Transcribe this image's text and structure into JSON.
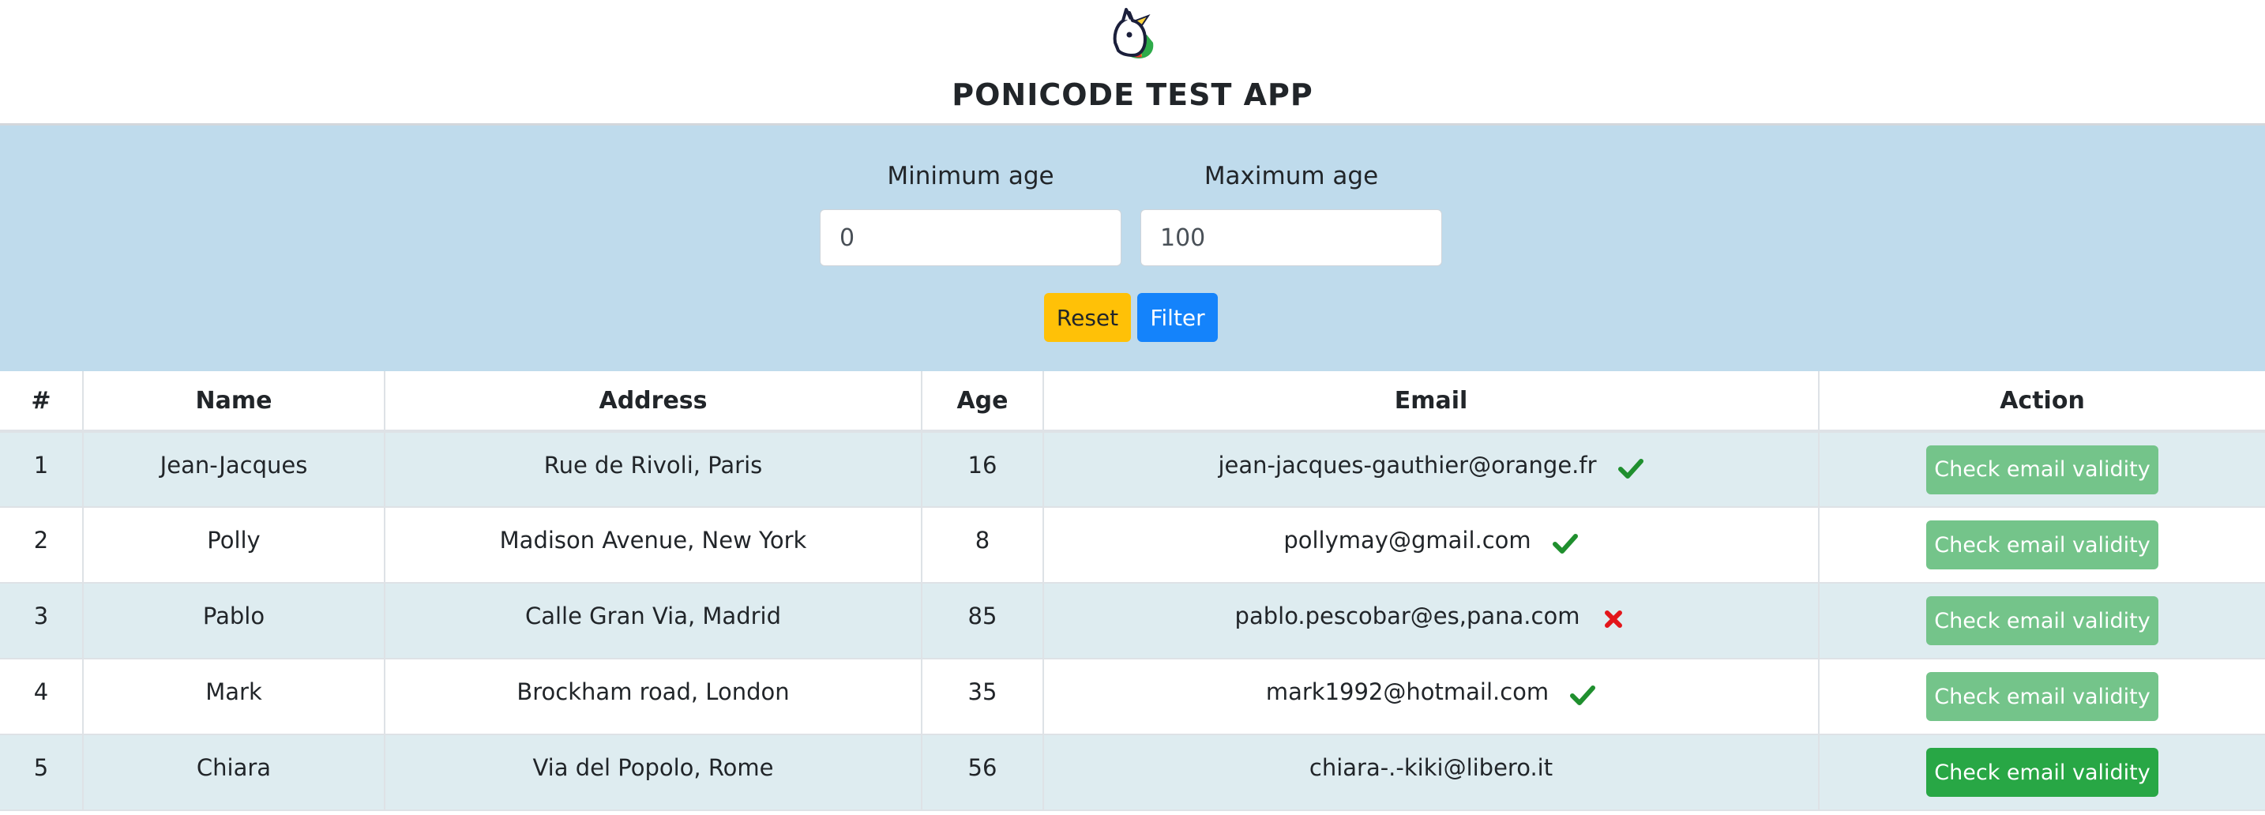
{
  "app": {
    "title": "PONICODE TEST APP"
  },
  "filters": {
    "min_label": "Minimum age",
    "max_label": "Maximum age",
    "min_value": "0",
    "max_value": "100",
    "reset_label": "Reset",
    "filter_label": "Filter"
  },
  "table": {
    "headers": {
      "index": "#",
      "name": "Name",
      "address": "Address",
      "age": "Age",
      "email": "Email",
      "action": "Action"
    },
    "rows": [
      {
        "index": "1",
        "name": "Jean-Jacques",
        "address": "Rue de Rivoli, Paris",
        "age": "16",
        "email": "jean-jacques-gauthier@orange.fr",
        "status": "valid",
        "action_label": "Check email validity",
        "action_state": "faded"
      },
      {
        "index": "2",
        "name": "Polly",
        "address": "Madison Avenue, New York",
        "age": "8",
        "email": "pollymay@gmail.com",
        "status": "valid",
        "action_label": "Check email validity",
        "action_state": "faded"
      },
      {
        "index": "3",
        "name": "Pablo",
        "address": "Calle Gran Via, Madrid",
        "age": "85",
        "email": "pablo.pescobar@es,pana.com",
        "status": "invalid",
        "action_label": "Check email validity",
        "action_state": "faded"
      },
      {
        "index": "4",
        "name": "Mark",
        "address": "Brockham road, London",
        "age": "35",
        "email": "mark1992@hotmail.com",
        "status": "valid",
        "action_label": "Check email validity",
        "action_state": "faded"
      },
      {
        "index": "5",
        "name": "Chiara",
        "address": "Via del Popolo, Rome",
        "age": "56",
        "email": "chiara-.-kiki@libero.it",
        "status": "unchecked",
        "action_label": "Check email validity",
        "action_state": "active"
      }
    ]
  },
  "icons": {
    "logo": "unicorn-logo-icon",
    "valid": "checkmark-icon",
    "invalid": "cross-icon"
  },
  "colors": {
    "filter_panel_bg": "#bfdbec",
    "reset_button": "#ffc107",
    "filter_button": "#1483fb",
    "check_button_faded": "#74c48a",
    "check_button_active": "#28a745",
    "valid_icon": "#1f8f2e",
    "invalid_icon": "#e3161b",
    "striped_row": "#deecf0"
  }
}
